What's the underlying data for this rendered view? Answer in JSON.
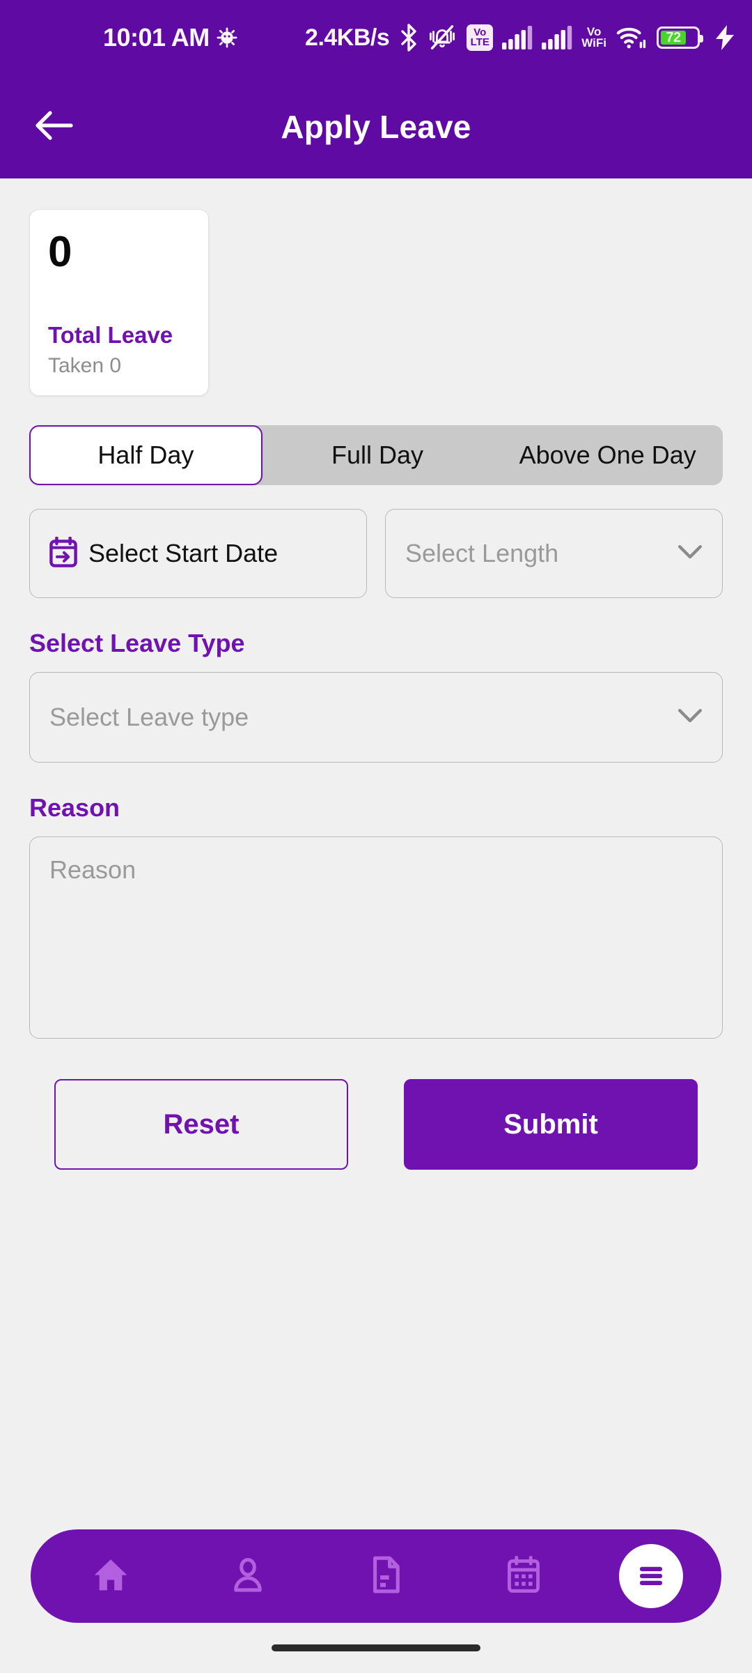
{
  "status_bar": {
    "time": "10:01 AM",
    "android_icon": "android-head-icon",
    "net_speed": "2.4KB/s",
    "bluetooth_icon": "bluetooth-icon",
    "ringer_silent_icon": "vibrate-off-icon",
    "volte_line1": "Vo",
    "volte_line2": "LTE",
    "signal_icon_1": "signal-bars-icon",
    "signal_icon_2": "signal-bars-icon",
    "vowifi_line1": "Vo",
    "vowifi_line2": "WiFi",
    "wifi_icon": "wifi-icon",
    "battery_percent": "72",
    "battery_level": 72,
    "charging_icon": "charging-bolt-icon",
    "battery_color": "#4ad32a"
  },
  "app_bar": {
    "back_icon": "back-arrow-icon",
    "title": "Apply Leave",
    "background": "#5f0ba3"
  },
  "stat_card": {
    "count": "0",
    "label": "Total Leave",
    "sub": "Taken 0"
  },
  "duration_tabs": {
    "items": [
      {
        "label": "Half Day",
        "active": true
      },
      {
        "label": "Full Day",
        "active": false
      },
      {
        "label": "Above One Day",
        "active": false
      }
    ]
  },
  "start_date": {
    "icon": "calendar-start-icon",
    "label": "Select Start Date"
  },
  "length": {
    "placeholder": "Select Length",
    "value": "",
    "chevron_icon": "chevron-down-icon"
  },
  "leave_type": {
    "section_label": "Select Leave Type",
    "placeholder": "Select Leave type",
    "value": "",
    "chevron_icon": "chevron-down-icon"
  },
  "reason": {
    "section_label": "Reason",
    "placeholder": "Reason",
    "value": ""
  },
  "actions": {
    "reset_label": "Reset",
    "submit_label": "Submit"
  },
  "bottom_nav": {
    "items": [
      {
        "name": "home",
        "icon": "home-icon",
        "active": false
      },
      {
        "name": "profile",
        "icon": "person-icon",
        "active": false
      },
      {
        "name": "documents",
        "icon": "document-icon",
        "active": false
      },
      {
        "name": "calendar",
        "icon": "calendar-icon",
        "active": false
      },
      {
        "name": "menu",
        "icon": "hamburger-menu-icon",
        "active": true
      }
    ]
  },
  "theme": {
    "primary": "#6f12b0",
    "header": "#5f0ba3",
    "page_bg": "#f0f0f0",
    "placeholder": "#9a9a9a",
    "border": "#b8b8b8"
  }
}
